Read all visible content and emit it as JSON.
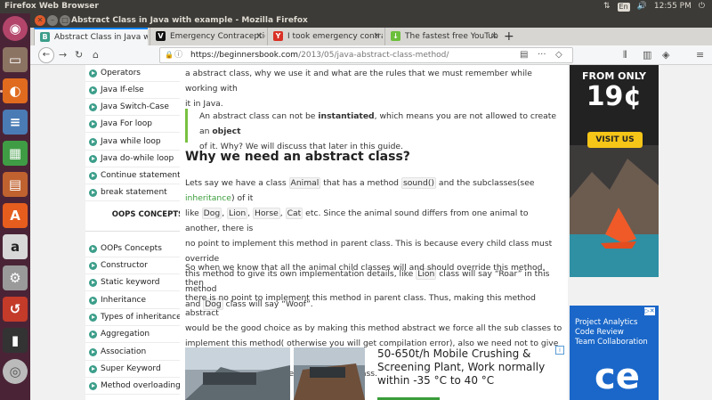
{
  "topbar": {
    "app_name": "Firefox Web Browser",
    "keyboard": "En",
    "clock": "12:55 PM"
  },
  "window": {
    "title": "Abstract Class in Java with example - Mozilla Firefox"
  },
  "tabs": [
    {
      "label": "Abstract Class in Java wi",
      "active": true,
      "favicon": "B",
      "favicon_color": "#3c9e8a"
    },
    {
      "label": "Emergency Contraceptio",
      "active": false,
      "favicon": "V",
      "favicon_color": "#111111"
    },
    {
      "label": "I took emergency contra",
      "active": false,
      "favicon": "Y",
      "favicon_color": "#d93025"
    },
    {
      "label": "The fastest free YouTub",
      "active": false,
      "favicon": "↓",
      "favicon_color": "#6bbf3b"
    }
  ],
  "navbar": {
    "url_host": "https://beginnersbook.com",
    "url_path": "/2013/05/java-abstract-class-method/",
    "url_more": "···"
  },
  "sidebar": {
    "items_top": [
      "Operators",
      "Java If-else",
      "Java Switch-Case",
      "Java For loop",
      "Java while loop",
      "Java do-while loop",
      "Continue statement",
      "break statement"
    ],
    "heading": "OOPS CONCEPTS",
    "items_bottom": [
      "OOPs Concepts",
      "Constructor",
      "Static keyword",
      "Inheritance",
      "Types of inheritance",
      "Aggregation",
      "Association",
      "Super Keyword",
      "Method overloading"
    ]
  },
  "content": {
    "p1_l1": "a abstract class, why we use it and what are the rules that we must remember while working with",
    "p1_l2": "it in Java.",
    "q_a": "An abstract class can not be ",
    "q_b": "instantiated",
    "q_c": ", which means you are not allowed to create an ",
    "q_d": "object",
    "q_e": "of it. Why? We will discuss that later in this guide.",
    "heading": "Why we need an abstract class?",
    "p2_a": "Lets say we have a class ",
    "p2_animal": "Animal",
    "p2_b": " that has a method ",
    "p2_sound": "sound()",
    "p2_c": " and the subclasses(see ",
    "p2_inh": "inheritance",
    "p2_d": ") of it",
    "p2_e": "like ",
    "p2_dog": "Dog",
    "p2_comma1": ", ",
    "p2_lion": "Lion",
    "p2_comma2": ", ",
    "p2_horse": "Horse",
    "p2_comma3": ", ",
    "p2_cat": "Cat",
    "p2_f": " etc. Since the animal sound differs from one animal to another, there is",
    "p2_g": "no point to implement this method in parent class. This is because every child class must override",
    "p2_h": "this method to give its own implementation details, like ",
    "p2_lion2": "Lion",
    "p2_i": " class will say “Roar” in this method",
    "p2_j": "and ",
    "p2_dog2": "Dog",
    "p2_k": " class will say “Woof”.",
    "p3_l1": "So when we know that all the animal child classes will and should override this method, then",
    "p3_l2": "there is no point to implement this method in parent class. Thus, making this method abstract",
    "p3_l3": "would be the good choice as by making this method abstract we force all the sub classes to",
    "p3_l4": "implement this method( otherwise you will get compilation error), also we need not to give any",
    "p3_l5": "implementation to this method in parent class."
  },
  "ad_bottom": {
    "text": "50-650t/h Mobile Crushing & Screening Plant, Work normally within -35 °C to 40 °C",
    "info": "i"
  },
  "ad_right_1": {
    "line1": "FROM ONLY",
    "price": "19¢",
    "button": "VISIT US"
  },
  "ad_right_2": {
    "line1": "Project Analytics",
    "line2": "Code Review",
    "line3": "Team Collaboration",
    "big": "ce"
  }
}
